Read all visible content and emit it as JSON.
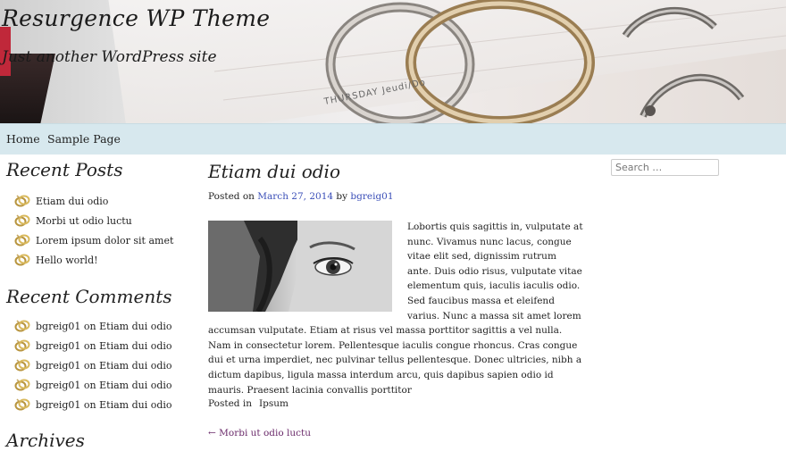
{
  "site": {
    "title": "Resurgence WP Theme",
    "description": "Just another WordPress site",
    "header_image_text": "THURSDAY Jeudi/Do"
  },
  "nav": {
    "items": [
      {
        "label": "Home"
      },
      {
        "label": "Sample Page"
      }
    ]
  },
  "sidebar": {
    "recent_posts": {
      "title": "Recent Posts",
      "items": [
        "Etiam dui odio",
        "Morbi ut odio luctu",
        "Lorem ipsum dolor sit amet",
        "Hello world!"
      ]
    },
    "recent_comments": {
      "title": "Recent Comments",
      "items": [
        {
          "author": "bgreig01",
          "on": "on",
          "post": "Etiam dui odio"
        },
        {
          "author": "bgreig01",
          "on": "on",
          "post": "Etiam dui odio"
        },
        {
          "author": "bgreig01",
          "on": "on",
          "post": "Etiam dui odio"
        },
        {
          "author": "bgreig01",
          "on": "on",
          "post": "Etiam dui odio"
        },
        {
          "author": "bgreig01",
          "on": "on",
          "post": "Etiam dui odio"
        }
      ]
    },
    "archives": {
      "title": "Archives"
    }
  },
  "post": {
    "title": "Etiam dui odio",
    "posted_on_label": "Posted on",
    "date": "March 27, 2014",
    "by_label": "by",
    "author": "bgreig01",
    "body": "Lobortis quis sagittis in, vulputate at nunc. Vivamus nunc lacus, congue vitae elit sed, dignissim rutrum ante. Duis odio risus, vulputate vitae elementum quis, iaculis iaculis odio. Sed faucibus massa et eleifend varius. Nunc a massa sit amet lorem accumsan vulputate. Etiam at risus vel massa porttitor sagittis a vel nulla. Nam in consectetur lorem. Pellentesque iaculis congue rhoncus. Cras congue dui et urna imperdiet, nec pulvinar tellus pellentesque. Donec ultricies, nibh a dictum dapibus, ligula massa interdum arcu, quis dapibus sapien odio id mauris. Praesent lacinia convallis porttitor",
    "posted_in_label": "Posted in",
    "category": "Ipsum",
    "prev_link": "← Morbi ut odio luctu"
  },
  "search": {
    "placeholder": "Search …"
  },
  "colors": {
    "nav_bg": "#d7e8ee",
    "link": "#3b4fb8",
    "prev_link": "#6a2a6a"
  }
}
